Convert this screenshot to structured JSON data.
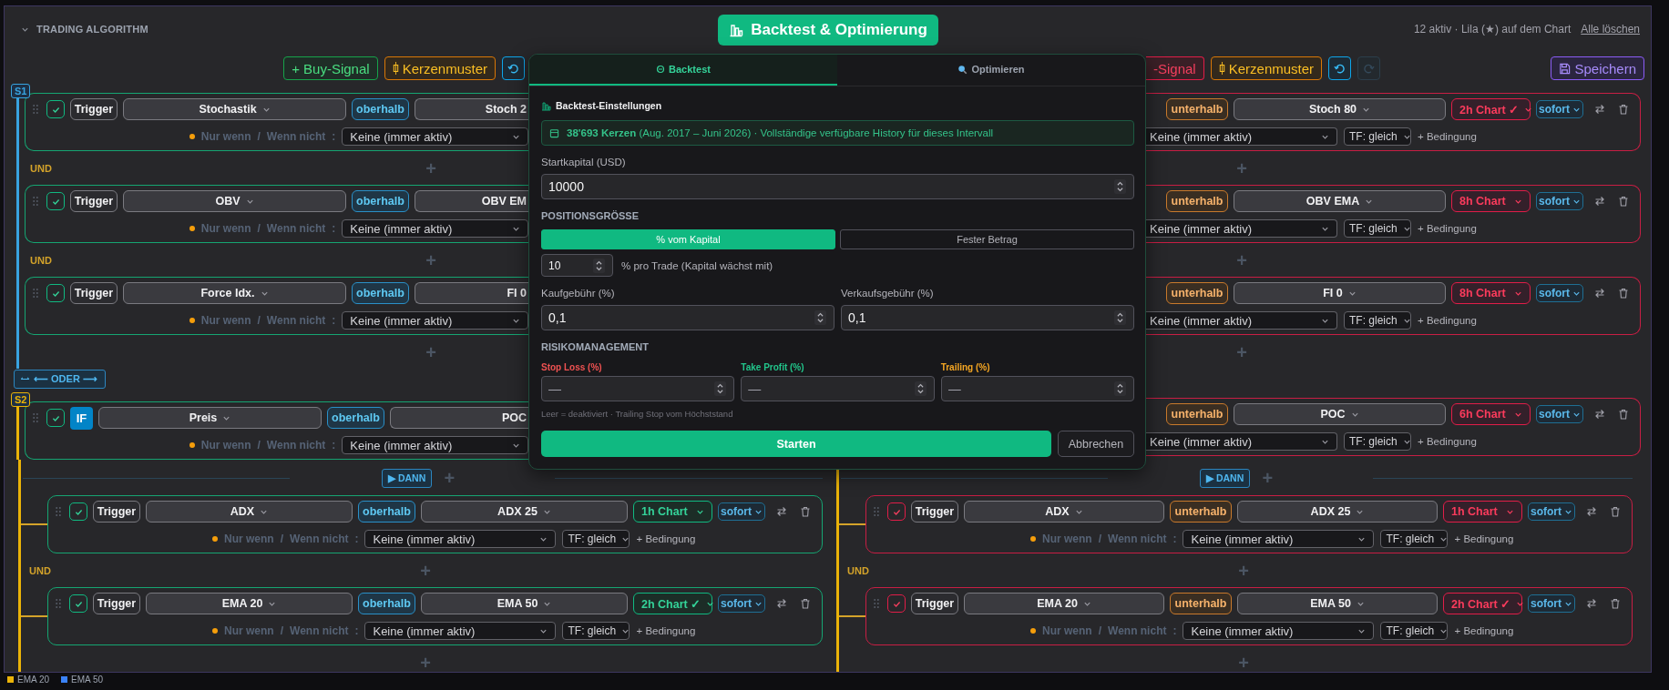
{
  "header": {
    "expanded": true,
    "title": "TRADING ALGORITHM",
    "action": "Backtest & Optimierung",
    "status": "12 aktiv · Lila (★) auf dem Chart",
    "clear": "Alle löschen"
  },
  "buy": {
    "toolbar": {
      "add": "+ Buy-Signal",
      "pattern": "Kerzenmuster",
      "undo_disabled": false
    },
    "groups": [
      {
        "label": "S1",
        "color": "#38a3e0",
        "items": [
          {
            "kind": "card",
            "enabled": true,
            "type": "Trigger",
            "indicator": "Stochastik",
            "operator": "oberhalb",
            "target": "Stoch 2",
            "only_if": "Nur wenn",
            "slash": "/",
            "unless": "Wenn nicht",
            "colon": ":",
            "filter": "Keine (immer aktiv)"
          },
          {
            "kind": "join",
            "label": "UND",
            "add": "+"
          },
          {
            "kind": "card",
            "enabled": true,
            "type": "Trigger",
            "indicator": "OBV",
            "operator": "oberhalb",
            "target": "OBV EM",
            "only_if": "Nur wenn",
            "slash": "/",
            "unless": "Wenn nicht",
            "colon": ":",
            "filter": "Keine (immer aktiv)"
          },
          {
            "kind": "join",
            "label": "UND",
            "add": "+"
          },
          {
            "kind": "card",
            "enabled": true,
            "type": "Trigger",
            "indicator": "Force Idx.",
            "operator": "oberhalb",
            "target": "FI 0",
            "only_if": "Nur wenn",
            "slash": "/",
            "unless": "Wenn nicht",
            "colon": ":",
            "filter": "Keine (immer aktiv)"
          },
          {
            "kind": "add",
            "add": "+"
          }
        ]
      },
      {
        "label": "S2",
        "color": "#eab308",
        "items": [
          {
            "kind": "if",
            "enabled": true,
            "type": "IF",
            "indicator": "Preis",
            "operator": "oberhalb",
            "target": "POC",
            "only_if": "Nur wenn",
            "slash": "/",
            "unless": "Wenn nicht",
            "colon": ":",
            "filter": "Keine (immer aktiv)"
          }
        ]
      }
    ],
    "or_button": "⟵ ODER ⟶"
  },
  "sell": {
    "toolbar": {
      "add": "-Signal",
      "pattern": "Kerzenmuster",
      "undo_disabled": false,
      "redo_disabled": true,
      "save": "Speichern"
    },
    "groups": [
      {
        "items": [
          {
            "kind": "card",
            "operator": "unterhalb",
            "target": "Stoch 80",
            "timeframe": "2h Chart ✓",
            "timing": "sofort",
            "filter": "Keine (immer aktiv)",
            "tf": "TF: gleich",
            "condition": "+ Bedingung"
          },
          {
            "kind": "add",
            "add": "+"
          },
          {
            "kind": "card",
            "operator": "unterhalb",
            "target": "OBV EMA",
            "timeframe": "8h Chart",
            "timing": "sofort",
            "filter": "Keine (immer aktiv)",
            "tf": "TF: gleich",
            "condition": "+ Bedingung"
          },
          {
            "kind": "add",
            "add": "+"
          },
          {
            "kind": "card",
            "operator": "unterhalb",
            "target": "FI 0",
            "timeframe": "8h Chart",
            "timing": "sofort",
            "filter": "Keine (immer aktiv)",
            "tf": "TF: gleich",
            "condition": "+ Bedingung"
          },
          {
            "kind": "add",
            "add": "+"
          }
        ]
      },
      {
        "items": [
          {
            "kind": "card",
            "operator": "unterhalb",
            "target": "POC",
            "timeframe": "6h Chart",
            "timing": "sofort",
            "filter": "Keine (immer aktiv)",
            "tf": "TF: gleich",
            "condition": "+ Bedingung"
          }
        ]
      }
    ]
  },
  "popup": {
    "tabs": [
      {
        "label": "Backtest",
        "selected": true
      },
      {
        "label": "Optimieren",
        "selected": false
      }
    ],
    "settings_title": "Backtest-Einstellungen",
    "info": "**38'693 Kerzen** (Aug. 2017 – Juni 2026) · Vollständige verfügbare History für dieses Intervall",
    "capital": {
      "label": "Startkapital (USD)",
      "value": "10000"
    },
    "position": {
      "title": "POSITIONSGRÖSSE",
      "modes": [
        {
          "label": "% vom Kapital",
          "selected": true
        },
        {
          "label": "Fester Betrag",
          "selected": false
        }
      ],
      "value": "10",
      "hint": "% pro Trade (Kapital wächst mit)"
    },
    "fees": [
      {
        "label": "Kaufgebühr (%)",
        "value": "0,1"
      },
      {
        "label": "Verkaufsgebühr (%)",
        "value": "0,1"
      }
    ],
    "risk": {
      "title": "RISIKOMANAGEMENT",
      "fields": [
        {
          "label": "Stop Loss (%)",
          "color": "#f05252",
          "placeholder": "—"
        },
        {
          "label": "Take Profit (%)",
          "color": "#22c58b",
          "placeholder": "—"
        },
        {
          "label": "Trailing (%)",
          "color": "#f5a623",
          "placeholder": "—"
        }
      ],
      "hint": "Leer = deaktiviert · Trailing Stop vom Höchststand"
    },
    "start": "Starten",
    "cancel": "Abbrechen"
  },
  "then": [
    {
      "label": "▶ DANN",
      "add": "+",
      "items": [
        {
          "kind": "card",
          "enabled": true,
          "type": "Trigger",
          "indicator": "ADX",
          "operator": "oberhalb",
          "target": "ADX 25",
          "timeframe": "1h Chart",
          "timing": "sofort",
          "only_if": "Nur wenn",
          "slash": "/",
          "unless": "Wenn nicht",
          "colon": ":",
          "filter": "Keine (immer aktiv)",
          "tf": "TF: gleich",
          "condition": "+ Bedingung"
        },
        {
          "kind": "join",
          "label": "UND",
          "add": "+"
        },
        {
          "kind": "card",
          "enabled": true,
          "type": "Trigger",
          "indicator": "EMA 20",
          "operator": "oberhalb",
          "target": "EMA 50",
          "timeframe": "2h Chart ✓",
          "timing": "sofort",
          "only_if": "Nur wenn",
          "slash": "/",
          "unless": "Wenn nicht",
          "colon": ":",
          "filter": "Keine (immer aktiv)",
          "tf": "TF: gleich",
          "condition": "+ Bedingung"
        },
        {
          "kind": "add",
          "add": "+"
        }
      ]
    },
    {
      "label": "▶ DANN",
      "add": "+",
      "items": [
        {
          "kind": "card",
          "enabled": true,
          "type": "Trigger",
          "indicator": "ADX",
          "operator": "unterhalb",
          "target": "ADX 25",
          "timeframe": "1h Chart",
          "timing": "sofort",
          "only_if": "Nur wenn",
          "slash": "/",
          "unless": "Wenn nicht",
          "colon": ":",
          "filter": "Keine (immer aktiv)",
          "tf": "TF: gleich",
          "condition": "+ Bedingung"
        },
        {
          "kind": "join",
          "label": "UND",
          "add": "+"
        },
        {
          "kind": "card",
          "enabled": true,
          "type": "Trigger",
          "indicator": "EMA 20",
          "operator": "unterhalb",
          "target": "EMA 50",
          "timeframe": "2h Chart ✓",
          "timing": "sofort",
          "only_if": "Nur wenn",
          "slash": "/",
          "unless": "Wenn nicht",
          "colon": ":",
          "filter": "Keine (immer aktiv)",
          "tf": "TF: gleich",
          "condition": "+ Bedingung"
        },
        {
          "kind": "add",
          "add": "+"
        }
      ]
    }
  ],
  "legend": [
    {
      "label": "EMA 20",
      "color": "#eab308"
    },
    {
      "label": "EMA 50",
      "color": "#3b82f6"
    }
  ]
}
